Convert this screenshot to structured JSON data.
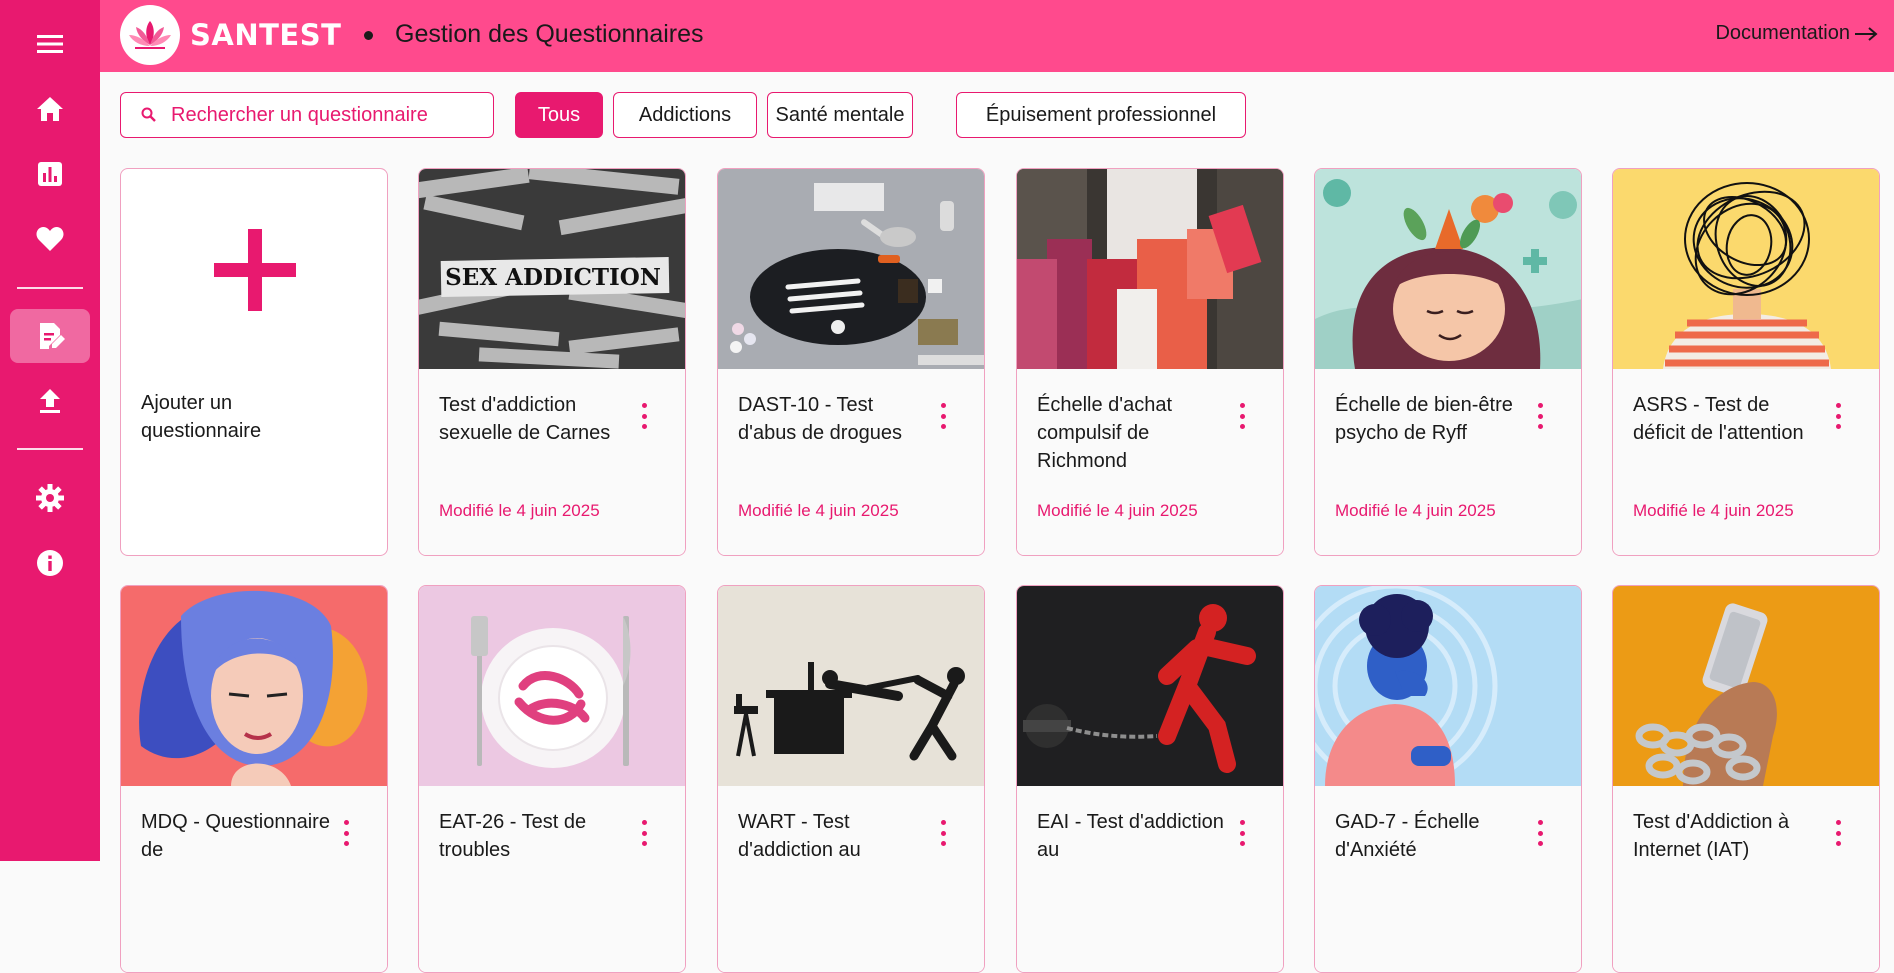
{
  "app": {
    "brand": "SANTEST",
    "title": "Gestion des Questionnaires",
    "doc_link": "Documentation"
  },
  "sidebar": {
    "items": [
      {
        "icon": "menu-icon"
      },
      {
        "icon": "home-icon"
      },
      {
        "icon": "chart-icon"
      },
      {
        "icon": "heart-icon"
      },
      {
        "icon": "edit-note-icon",
        "active": true
      },
      {
        "icon": "upload-icon"
      },
      {
        "icon": "gear-icon"
      },
      {
        "icon": "info-icon"
      }
    ]
  },
  "search": {
    "placeholder": "Rechercher un questionnaire"
  },
  "filters": [
    {
      "label": "Tous",
      "active": true
    },
    {
      "label": "Addictions"
    },
    {
      "label": "Santé mentale"
    },
    {
      "label": "Épuisement professionnel"
    }
  ],
  "add_card": {
    "label": "Ajouter un questionnaire"
  },
  "cards": [
    {
      "title": "Test d'addiction sexuelle de Carnes",
      "date": "Modifié le 4 juin 2025"
    },
    {
      "title": "DAST-10 - Test d'abus de drogues",
      "date": "Modifié le 4 juin 2025"
    },
    {
      "title": "Échelle d'achat compulsif de Richmond",
      "date": "Modifié le 4 juin 2025"
    },
    {
      "title": "Échelle de bien-être psycho de Ryff",
      "date": "Modifié le 4 juin 2025"
    },
    {
      "title": "ASRS - Test de déficit de l'attention",
      "date": "Modifié le 4 juin 2025"
    },
    {
      "title": "MDQ - Questionnaire de",
      "date": ""
    },
    {
      "title": "EAT-26 - Test de troubles",
      "date": ""
    },
    {
      "title": "WART - Test d'addiction au",
      "date": ""
    },
    {
      "title": "EAI - Test d'addiction au",
      "date": ""
    },
    {
      "title": "GAD-7 - Échelle d'Anxiété",
      "date": ""
    },
    {
      "title": "Test d'Addiction à Internet (IAT)",
      "date": ""
    }
  ],
  "colors": {
    "primary": "#e8196f",
    "topbar": "#ff4a8d",
    "card_border": "#f0a0c0"
  }
}
